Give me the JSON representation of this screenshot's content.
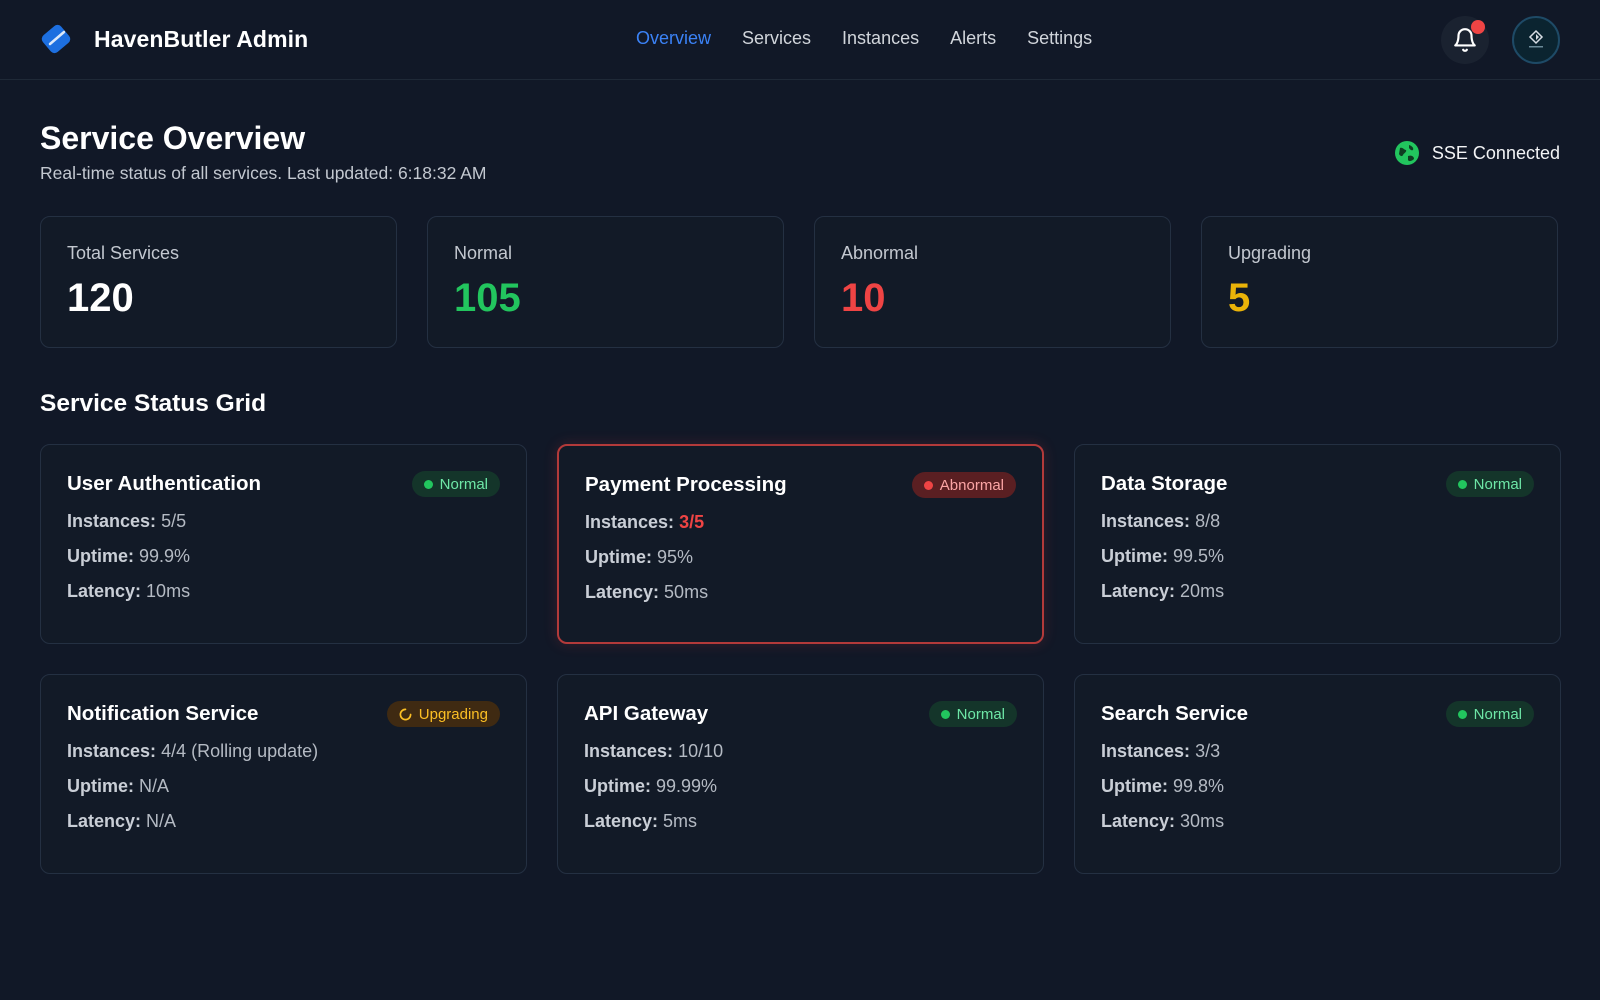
{
  "app": {
    "brand": "HavenButler Admin",
    "nav": [
      {
        "label": "Overview",
        "active": true
      },
      {
        "label": "Services",
        "active": false
      },
      {
        "label": "Instances",
        "active": false
      },
      {
        "label": "Alerts",
        "active": false
      },
      {
        "label": "Settings",
        "active": false
      }
    ],
    "notifications_icon": "bell-icon",
    "has_unread": true
  },
  "page": {
    "title": "Service Overview",
    "subtitle": "Real-time status of all services. Last updated: 6:18:32 AM",
    "connection": {
      "label": "SSE Connected",
      "icon": "globe-icon",
      "color": "#22c55e"
    }
  },
  "stats": [
    {
      "label": "Total Services",
      "value": "120",
      "color": "#ffffff"
    },
    {
      "label": "Normal",
      "value": "105",
      "color": "#22c55e"
    },
    {
      "label": "Abnormal",
      "value": "10",
      "color": "#ef4444"
    },
    {
      "label": "Upgrading",
      "value": "5",
      "color": "#eab308"
    }
  ],
  "grid": {
    "title": "Service Status Grid",
    "field_labels": {
      "instances": "Instances:",
      "uptime": "Uptime:",
      "latency": "Latency:"
    },
    "services": [
      {
        "name": "User Authentication",
        "status": "Normal",
        "instances": "5/5",
        "uptime": "99.9%",
        "latency": "10ms"
      },
      {
        "name": "Payment Processing",
        "status": "Abnormal",
        "instances": "3/5",
        "uptime": "95%",
        "latency": "50ms"
      },
      {
        "name": "Data Storage",
        "status": "Normal",
        "instances": "8/8",
        "uptime": "99.5%",
        "latency": "20ms"
      },
      {
        "name": "Notification Service",
        "status": "Upgrading",
        "instances": "4/4 (Rolling update)",
        "uptime": "N/A",
        "latency": "N/A"
      },
      {
        "name": "API Gateway",
        "status": "Normal",
        "instances": "10/10",
        "uptime": "99.99%",
        "latency": "5ms"
      },
      {
        "name": "Search Service",
        "status": "Normal",
        "instances": "3/3",
        "uptime": "99.8%",
        "latency": "30ms"
      }
    ]
  }
}
